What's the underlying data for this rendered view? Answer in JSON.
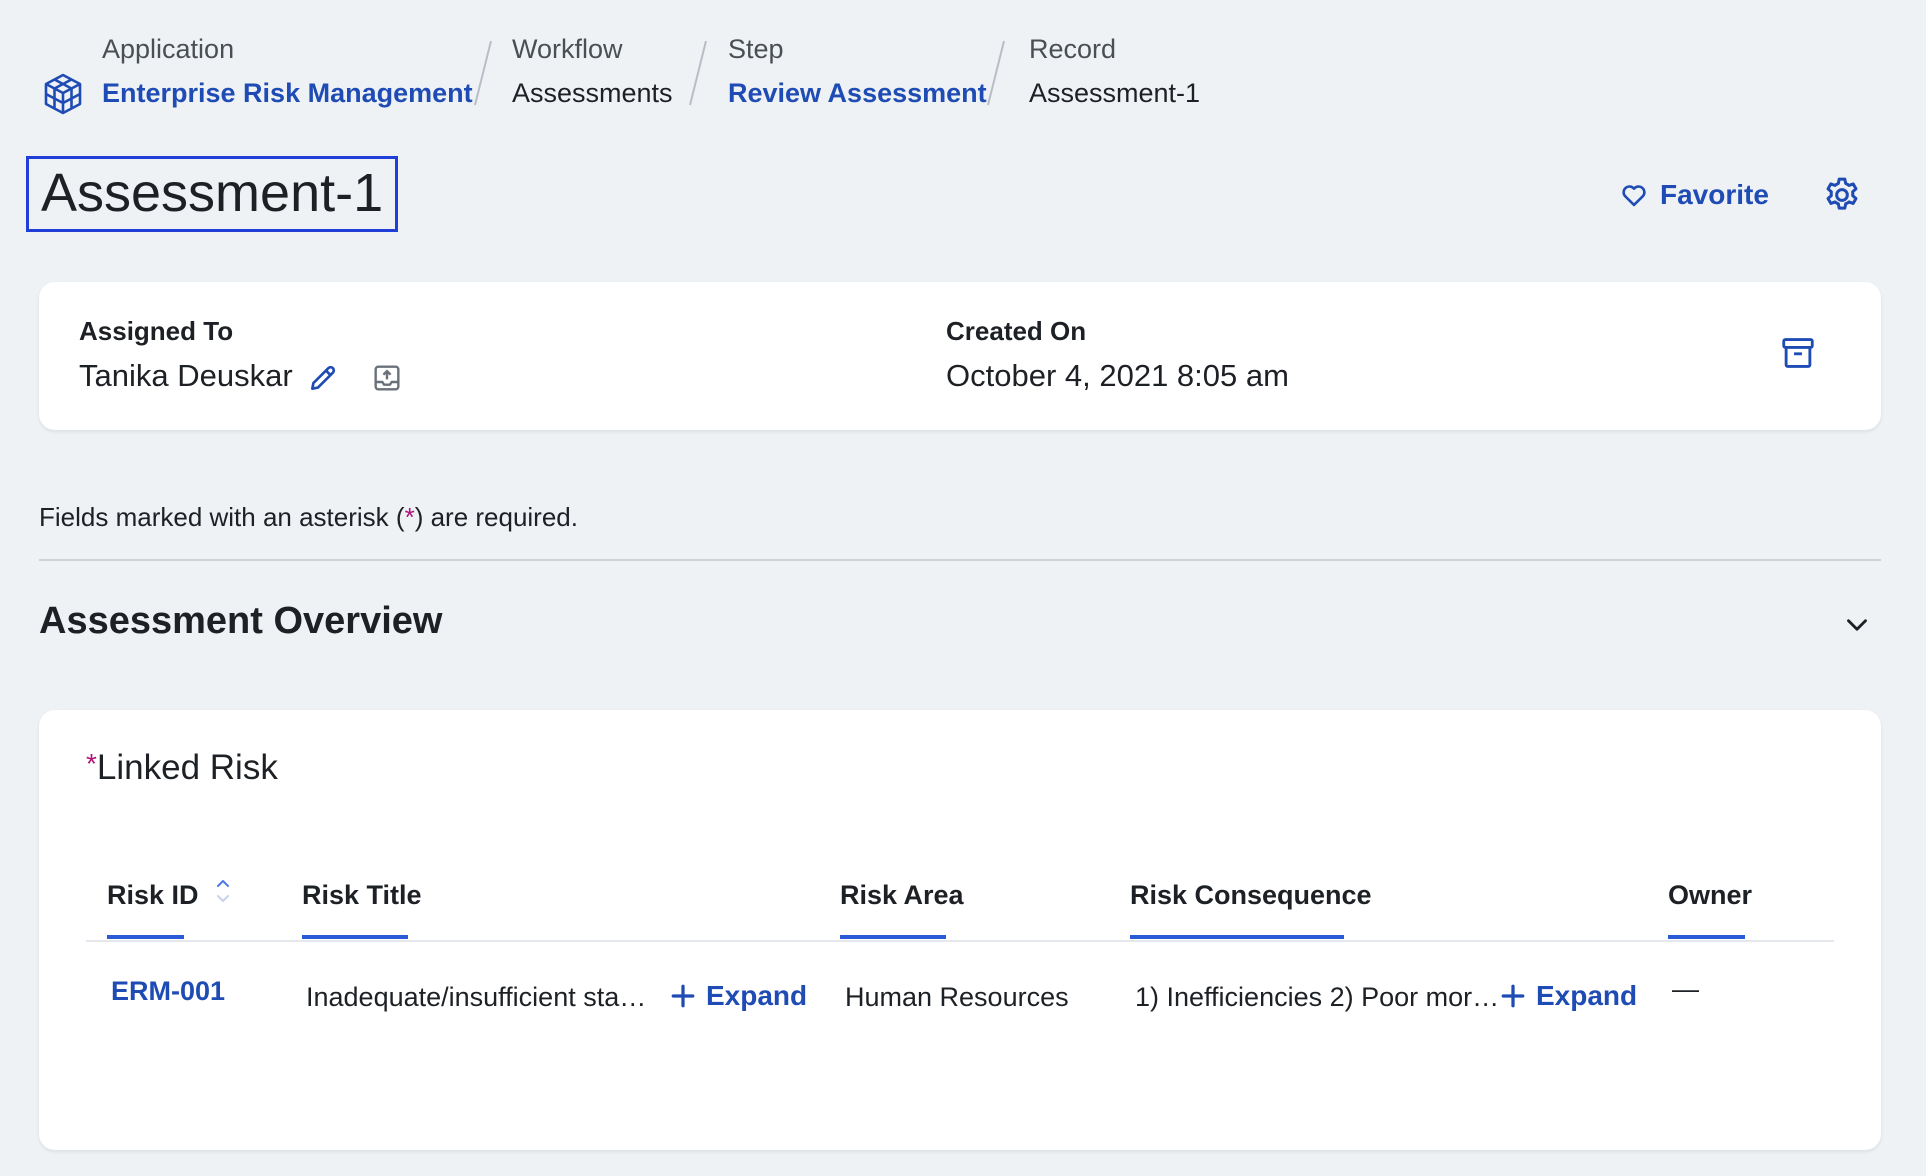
{
  "breadcrumb": {
    "application": {
      "label": "Application",
      "value": "Enterprise Risk Management"
    },
    "workflow": {
      "label": "Workflow",
      "value": "Assessments"
    },
    "step": {
      "label": "Step",
      "value": "Review Assessment"
    },
    "record": {
      "label": "Record",
      "value": "Assessment-1"
    }
  },
  "page": {
    "title": "Assessment-1",
    "favorite_label": "Favorite"
  },
  "summary": {
    "assigned_to_label": "Assigned To",
    "assigned_to_value": "Tanika Deuskar",
    "created_on_label": "Created On",
    "created_on_value": "October 4, 2021 8:05 am"
  },
  "form": {
    "required_note_prefix": "Fields marked with an asterisk (",
    "required_note_asterisk": "*",
    "required_note_suffix": ") are required.",
    "section_title": "Assessment Overview",
    "linked_risk_asterisk": "*",
    "linked_risk_label": "Linked Risk"
  },
  "table": {
    "headers": [
      "Risk ID",
      "Risk Title",
      "Risk Area",
      "Risk Consequence",
      "Owner"
    ],
    "rows": [
      {
        "risk_id": "ERM-001",
        "risk_title": "Inadequate/insufficient sta…",
        "risk_area": "Human Resources",
        "risk_consequence": "1) Inefficiencies 2) Poor mor…",
        "owner": "—"
      }
    ],
    "expand_label": "Expand"
  },
  "colors": {
    "accent": "#1f4bb4",
    "underline": "#2a5bd7",
    "required": "#b0137a",
    "focus_border": "#1f3fd8",
    "background": "#eff2f5"
  },
  "icons": {
    "app": "cube-icon",
    "favorite": "heart-icon",
    "settings": "gear-icon",
    "edit": "pencil-icon",
    "reassign": "upload-tray-icon",
    "archive": "archive-icon",
    "collapse": "chevron-down-icon",
    "sort": "sort-icon",
    "expand": "plus-icon"
  }
}
